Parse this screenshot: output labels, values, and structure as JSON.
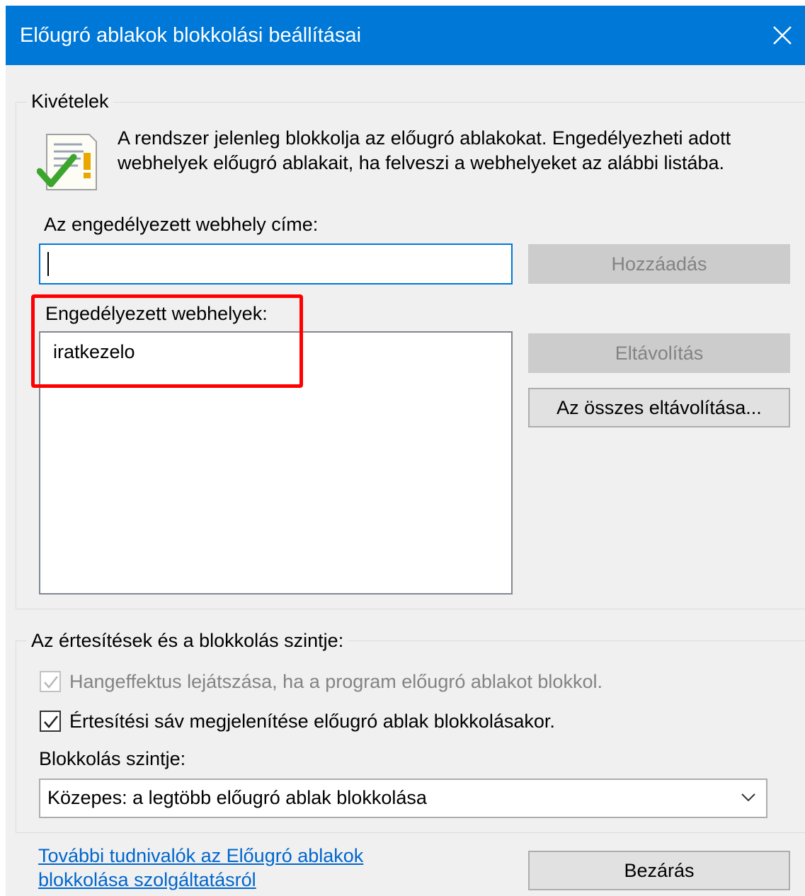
{
  "window": {
    "title": "Előugró ablakok blokkolási beállításai"
  },
  "exceptions": {
    "legend": "Kivételek",
    "info": "A rendszer jelenleg blokkolja az előugró ablakokat. Engedélyezheti adott webhelyek előugró ablakait, ha felveszi a webhelyeket az alábbi listába.",
    "address_label": "Az engedélyezett webhely címe:",
    "address_value": "",
    "add_button": "Hozzáadás",
    "allowed_label": "Engedélyezett webhelyek:",
    "allowed_sites": [
      "iratkezelo"
    ],
    "remove_button": "Eltávolítás",
    "remove_all_button": "Az összes eltávolítása..."
  },
  "notifications": {
    "legend": "Az értesítések és a blokkolás szintje:",
    "sound_checkbox": "Hangeffektus lejátszása, ha a program előugró ablakot blokkol.",
    "bar_checkbox": "Értesítési sáv megjelenítése előugró ablak blokkolásakor.",
    "level_label": "Blokkolás szintje:",
    "level_value": "Közepes: a legtöbb előugró ablak blokkolása"
  },
  "footer": {
    "link_line1": "További tudnivalók az Előugró ablakok",
    "link_line2": "blokkolása szolgáltatásról",
    "close_button": "Bezárás"
  },
  "colors": {
    "titlebar": "#0078d7",
    "highlight": "#ff0000",
    "link": "#0066cc"
  }
}
